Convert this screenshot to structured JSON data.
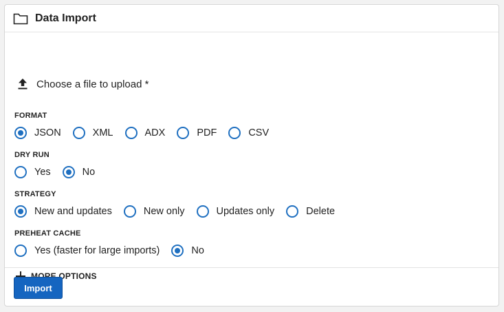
{
  "header": {
    "title": "Data Import",
    "icon": "folder-icon"
  },
  "upload": {
    "label": "Choose a file to upload *",
    "icon": "upload-icon"
  },
  "groups": {
    "format": {
      "label": "FORMAT",
      "options": [
        "JSON",
        "XML",
        "ADX",
        "PDF",
        "CSV"
      ],
      "selected": "JSON"
    },
    "dry_run": {
      "label": "DRY RUN",
      "options": [
        "Yes",
        "No"
      ],
      "selected": "No"
    },
    "strategy": {
      "label": "STRATEGY",
      "options": [
        "New and updates",
        "New only",
        "Updates only",
        "Delete"
      ],
      "selected": "New and updates"
    },
    "preheat_cache": {
      "label": "PREHEAT CACHE",
      "options": [
        "Yes (faster for large imports)",
        "No"
      ],
      "selected": "No"
    }
  },
  "more_options": {
    "label": "MORE OPTIONS",
    "icon": "plus-icon"
  },
  "footer": {
    "import_label": "Import"
  },
  "colors": {
    "accent": "#1e6fc0",
    "button": "#1565c0"
  }
}
